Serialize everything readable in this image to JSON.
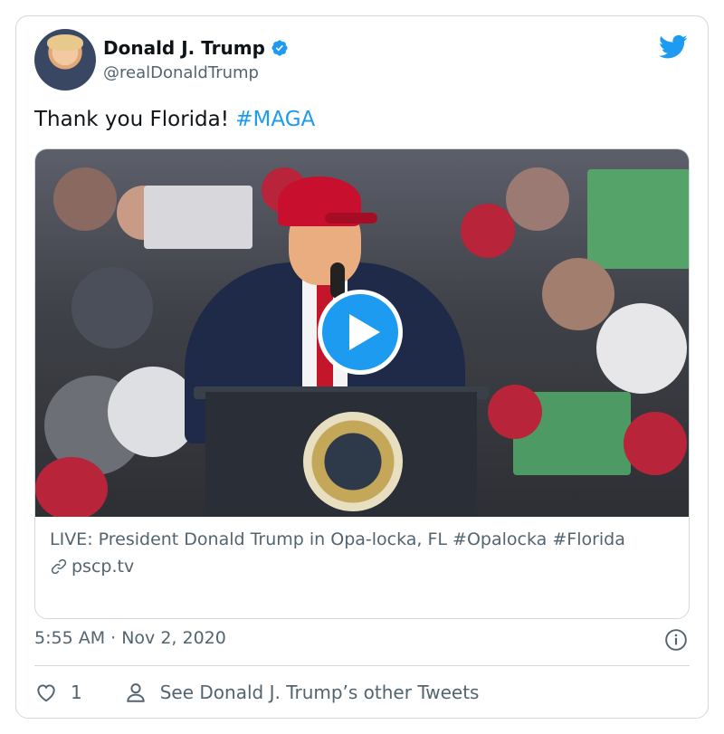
{
  "author": {
    "display_name": "Donald J. Trump",
    "handle": "@realDonaldTrump"
  },
  "tweet": {
    "text_plain": "Thank you Florida! ",
    "hashtag": "#MAGA"
  },
  "link_card": {
    "title": "LIVE: President Donald Trump in Opa-locka, FL #Opalocka #Florida",
    "domain": "pscp.tv"
  },
  "meta": {
    "timestamp": "5:55 AM · Nov 2, 2020"
  },
  "actions": {
    "like_count": "1",
    "see_other_tweets": "See Donald J. Trump’s other Tweets"
  },
  "colors": {
    "accent": "#1d9bf0",
    "secondary_text": "#536471",
    "border": "#cfd9de"
  },
  "icons": [
    "verified-badge-icon",
    "twitter-bird-icon",
    "play-icon",
    "link-icon",
    "info-icon",
    "heart-icon",
    "person-icon"
  ]
}
